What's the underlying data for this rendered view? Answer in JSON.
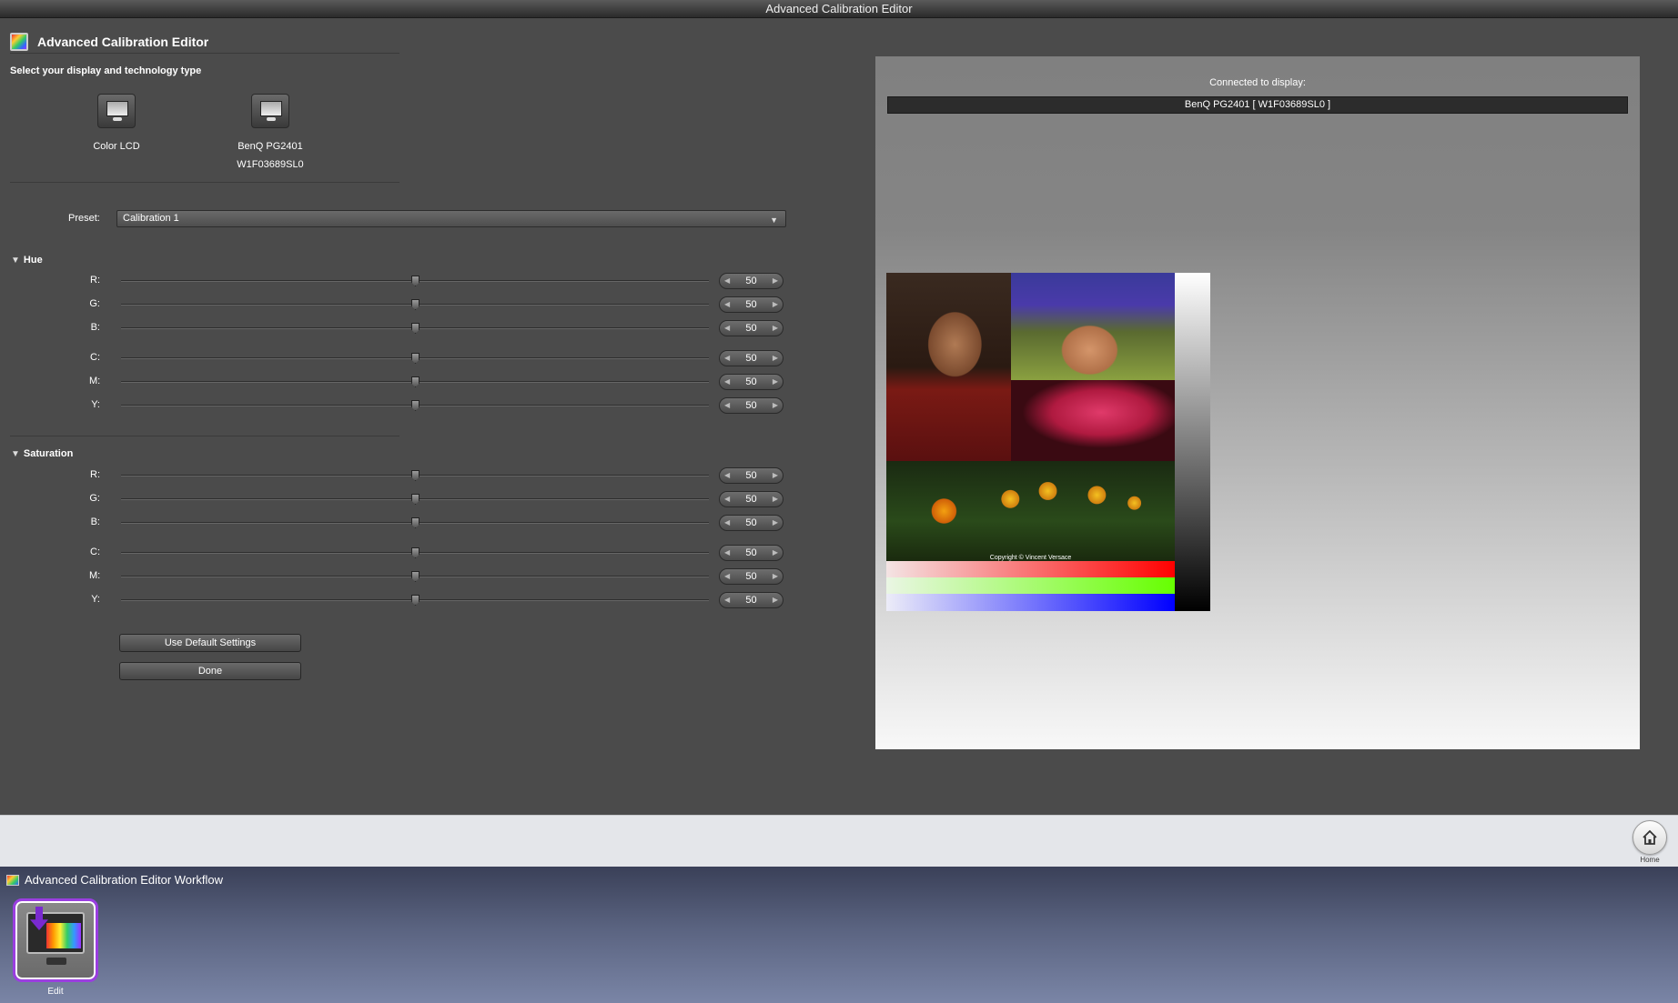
{
  "window": {
    "title": "Advanced Calibration Editor"
  },
  "header": {
    "title": "Advanced Calibration Editor",
    "icon": "calibration-app-icon"
  },
  "display_select": {
    "label": "Select your display and technology type",
    "displays": [
      {
        "name": "Color LCD",
        "serial": ""
      },
      {
        "name": "BenQ PG2401",
        "serial": "W1F03689SL0"
      }
    ]
  },
  "preset": {
    "label": "Preset:",
    "value": "Calibration 1"
  },
  "hue": {
    "title": "Hue",
    "rows": [
      {
        "label": "R:",
        "value": "50"
      },
      {
        "label": "G:",
        "value": "50"
      },
      {
        "label": "B:",
        "value": "50"
      },
      {
        "label": "C:",
        "value": "50"
      },
      {
        "label": "M:",
        "value": "50"
      },
      {
        "label": "Y:",
        "value": "50"
      }
    ]
  },
  "saturation": {
    "title": "Saturation",
    "rows": [
      {
        "label": "R:",
        "value": "50"
      },
      {
        "label": "G:",
        "value": "50"
      },
      {
        "label": "B:",
        "value": "50"
      },
      {
        "label": "C:",
        "value": "50"
      },
      {
        "label": "M:",
        "value": "50"
      },
      {
        "label": "Y:",
        "value": "50"
      }
    ]
  },
  "buttons": {
    "defaults": "Use Default Settings",
    "done": "Done"
  },
  "preview": {
    "connected_label": "Connected to display:",
    "connected_value": "BenQ PG2401 [ W1F03689SL0 ]",
    "copyright": "Copyright © Vincent Versace"
  },
  "home": {
    "label": "Home"
  },
  "workflow": {
    "title": "Advanced Calibration Editor Workflow",
    "step_label": "Edit",
    "accent": "#9a3ee0"
  }
}
